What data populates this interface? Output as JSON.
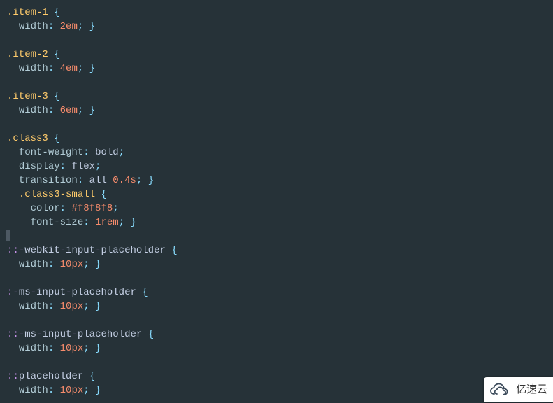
{
  "code": {
    "rules": [
      {
        "selector": ".item-1",
        "bracePad": " ",
        "indent": 0,
        "declarations": [
          {
            "prop": "width",
            "value": "2em"
          }
        ]
      },
      {
        "selector": ".item-2",
        "bracePad": " ",
        "indent": 0,
        "declarations": [
          {
            "prop": "width",
            "value": "4em"
          }
        ]
      },
      {
        "selector": ".item-3",
        "bracePad": " ",
        "indent": 0,
        "declarations": [
          {
            "prop": "width",
            "value": "6em"
          }
        ]
      },
      {
        "selector": ".class3",
        "bracePad": " ",
        "indent": 0,
        "declarations": [
          {
            "prop": "font-weight",
            "value": "bold"
          },
          {
            "prop": "display",
            "value": "flex"
          },
          {
            "prop": "transition",
            "value": "all 0.4s"
          }
        ],
        "nested": [
          {
            "selector": ".class3-small",
            "bracePad": " ",
            "indent": 1,
            "declarations": [
              {
                "prop": "color",
                "value": "#f8f8f8"
              },
              {
                "prop": "font-size",
                "value": "1rem"
              }
            ]
          }
        ]
      },
      {
        "selector": "::-webkit-input-placeholder",
        "bracePad": " ",
        "indent": 0,
        "declarations": [
          {
            "prop": "width",
            "value": "10px"
          }
        ]
      },
      {
        "selector": ":-ms-input-placeholder",
        "bracePad": " ",
        "indent": 0,
        "declarations": [
          {
            "prop": "width",
            "value": "10px"
          }
        ]
      },
      {
        "selector": "::-ms-input-placeholder",
        "bracePad": " ",
        "indent": 0,
        "declarations": [
          {
            "prop": "width",
            "value": "10px"
          }
        ]
      },
      {
        "selector": "::placeholder",
        "bracePad": " ",
        "indent": 0,
        "declarations": [
          {
            "prop": "width",
            "value": "10px"
          }
        ]
      }
    ],
    "cursor_after_rule_index": 3
  },
  "colors": {
    "bg": "#263238",
    "selector": "#ffcb6b",
    "punct": "#89ddff",
    "prop": "#b2ccd6",
    "value": "#f78c6c",
    "pseudo": "#c792ea"
  },
  "watermark": {
    "text": "亿速云"
  }
}
